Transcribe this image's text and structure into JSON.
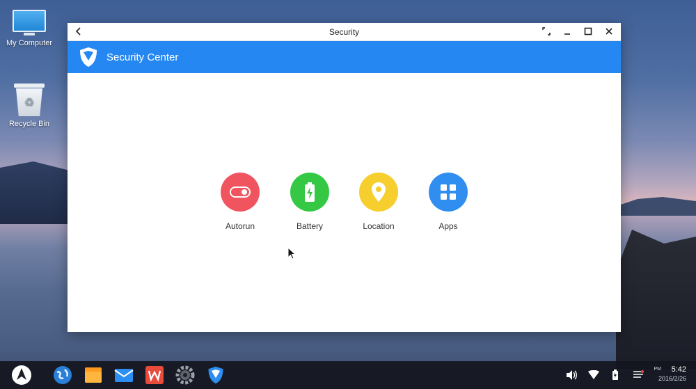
{
  "desktop": {
    "icons": [
      {
        "label": "My Computer"
      },
      {
        "label": "Recycle Bin"
      }
    ]
  },
  "window": {
    "title": "Security",
    "app_title": "Security Center",
    "features": [
      {
        "label": "Autorun",
        "color": "#f0555f",
        "icon": "toggle-icon"
      },
      {
        "label": "Battery",
        "color": "#35c845",
        "icon": "battery-icon"
      },
      {
        "label": "Location",
        "color": "#f6cf2e",
        "icon": "location-pin-icon"
      },
      {
        "label": "Apps",
        "color": "#2f8ef0",
        "icon": "grid-apps-icon"
      }
    ]
  },
  "taskbar": {
    "apps": [
      "start-icon",
      "browser-globe-icon",
      "file-manager-icon",
      "mail-icon",
      "office-icon",
      "settings-icon",
      "security-center-icon"
    ],
    "tray": [
      "volume-icon",
      "wifi-icon",
      "battery-charging-icon",
      "notifications-icon"
    ],
    "clock": {
      "ampm": "PM",
      "time": "5:42",
      "date": "2016/2/26"
    }
  },
  "colors": {
    "accent": "#2588f2"
  }
}
